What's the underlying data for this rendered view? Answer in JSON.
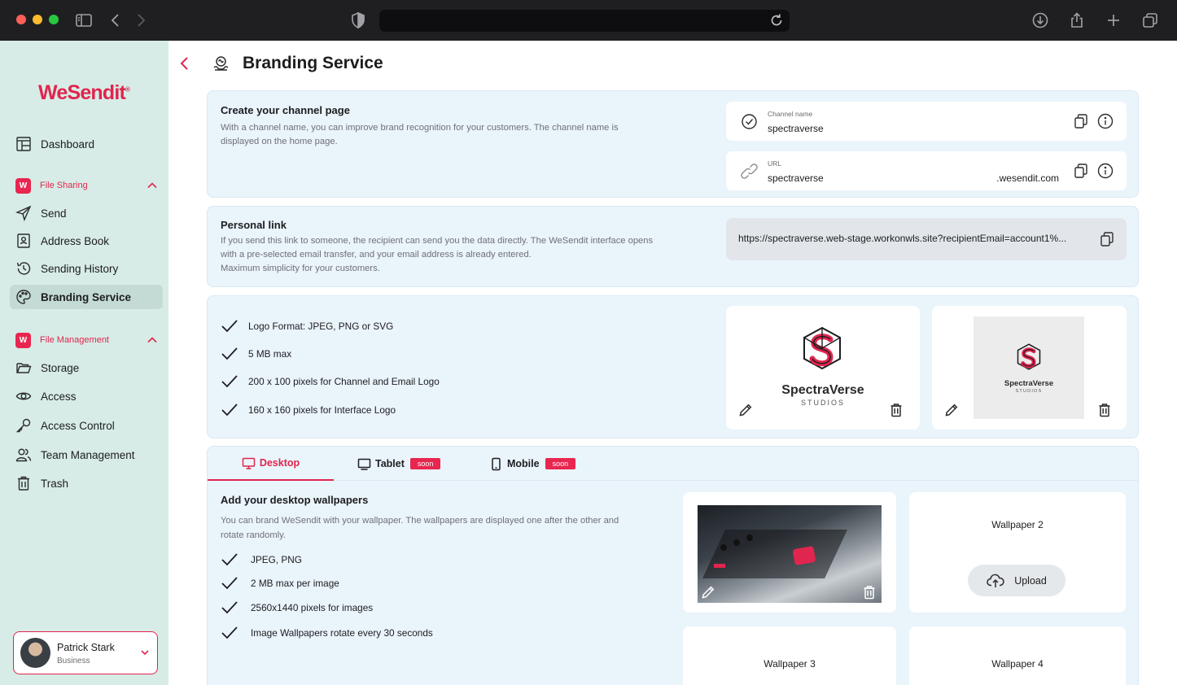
{
  "app": {
    "brand": "WeSendit"
  },
  "sidebar": {
    "dashboard": "Dashboard",
    "file_sharing": {
      "title": "File Sharing",
      "badge": "W",
      "items": [
        "Send",
        "Address Book",
        "Sending History",
        "Branding Service"
      ]
    },
    "file_management": {
      "title": "File Management",
      "badge": "W",
      "items": [
        "Storage",
        "Access",
        "Access Control",
        "Team Management",
        "Trash"
      ]
    },
    "active_item": "Branding Service"
  },
  "user": {
    "name": "Patrick Stark",
    "role": "Business"
  },
  "page": {
    "title": "Branding Service"
  },
  "channel": {
    "title": "Create your channel page",
    "desc_line1": "With a channel name, you can improve brand recognition for your customers. The channel name is",
    "desc_line2": "displayed on the home page.",
    "name_label": "Channel name",
    "name_value": "spectraverse",
    "url_label": "URL",
    "url_value": "spectraverse",
    "url_suffix": ".wesendit.com"
  },
  "personal_link": {
    "title": "Personal link",
    "desc_line1": "If you send this link to someone, the recipient can send you the data directly. The WeSendit interface opens",
    "desc_line2": "with a pre-selected email transfer, and your email address is already entered.",
    "desc_line3": "Maximum simplicity for your customers.",
    "url": "https://spectraverse.web-stage.workonwls.site?recipientEmail=account1%..."
  },
  "logo_requirements": [
    "Logo Format: JPEG, PNG or SVG",
    "5 MB max",
    "200 x 100 pixels for Channel and Email Logo",
    "160 x 160 pixels for Interface Logo"
  ],
  "logos": {
    "name": "SpectraVerse",
    "sub": "STUDIOS"
  },
  "tabs": [
    {
      "label": "Desktop",
      "badge": ""
    },
    {
      "label": "Tablet",
      "badge": "soon"
    },
    {
      "label": "Mobile",
      "badge": "soon"
    }
  ],
  "wallpapers": {
    "title": "Add your desktop wallpapers",
    "desc_line1": "You can brand WeSendit with your wallpaper. The wallpapers are displayed one after the other and",
    "desc_line2": "rotate randomly.",
    "requirements": [
      "JPEG, PNG",
      "2 MB max per image",
      "2560x1440 pixels for images",
      "Image Wallpapers rotate every 30 seconds"
    ],
    "slot2": "Wallpaper 2",
    "slot3": "Wallpaper 3",
    "slot4": "Wallpaper 4",
    "upload": "Upload"
  },
  "colors": {
    "accent": "#e0254f",
    "sidebar_bg": "#d7ece6",
    "card_bg": "#eaf4fb"
  }
}
